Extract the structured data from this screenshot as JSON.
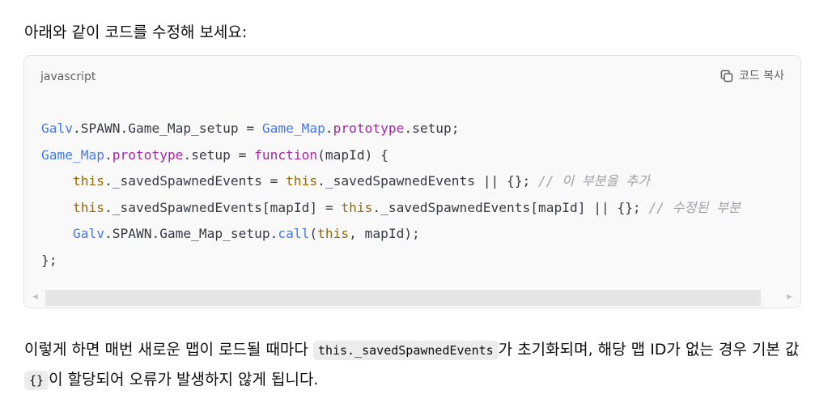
{
  "intro_text": "아래와 같이 코드를 수정해 보세요:",
  "code_block": {
    "language": "javascript",
    "copy_label": "코드 복사",
    "copy_icon": "copy-icon",
    "lines": [
      [
        [
          "obj",
          "Galv"
        ],
        [
          "pl",
          ".SPAWN.Game_Map_setup = "
        ],
        [
          "obj",
          "Game_Map"
        ],
        [
          "pl",
          "."
        ],
        [
          "prop",
          "prototype"
        ],
        [
          "pl",
          ".setup;"
        ]
      ],
      [
        [
          "obj",
          "Game_Map"
        ],
        [
          "pl",
          "."
        ],
        [
          "prop",
          "prototype"
        ],
        [
          "pl",
          ".setup = "
        ],
        [
          "kw",
          "function"
        ],
        [
          "pl",
          "(mapId) {"
        ]
      ],
      [
        [
          "pl",
          "    "
        ],
        [
          "this",
          "this"
        ],
        [
          "pl",
          "._savedSpawnedEvents = "
        ],
        [
          "this",
          "this"
        ],
        [
          "pl",
          "._savedSpawnedEvents || {}; "
        ],
        [
          "cm",
          "// 이 부분을 추가"
        ]
      ],
      [
        [
          "pl",
          "    "
        ],
        [
          "this",
          "this"
        ],
        [
          "pl",
          "._savedSpawnedEvents[mapId] = "
        ],
        [
          "this",
          "this"
        ],
        [
          "pl",
          "._savedSpawnedEvents[mapId] || {}; "
        ],
        [
          "cm",
          "// 수정된 부분"
        ]
      ],
      [
        [
          "pl",
          "    "
        ],
        [
          "obj",
          "Galv"
        ],
        [
          "pl",
          ".SPAWN.Game_Map_setup."
        ],
        [
          "obj",
          "call"
        ],
        [
          "pl",
          "("
        ],
        [
          "this",
          "this"
        ],
        [
          "pl",
          ", mapId);"
        ]
      ],
      [
        [
          "pl",
          "};"
        ]
      ]
    ]
  },
  "paragraph": {
    "part1": "이렇게 하면 매번 새로운 맵이 로드될 때마다 ",
    "code1": "this._savedSpawnedEvents",
    "part2": "가 초기화되며, 해당 맵 ID가 없는 경우 기본 값 ",
    "code2": "{}",
    "part3": "이 할당되어 오류가 발생하지 않게 됩니다."
  }
}
